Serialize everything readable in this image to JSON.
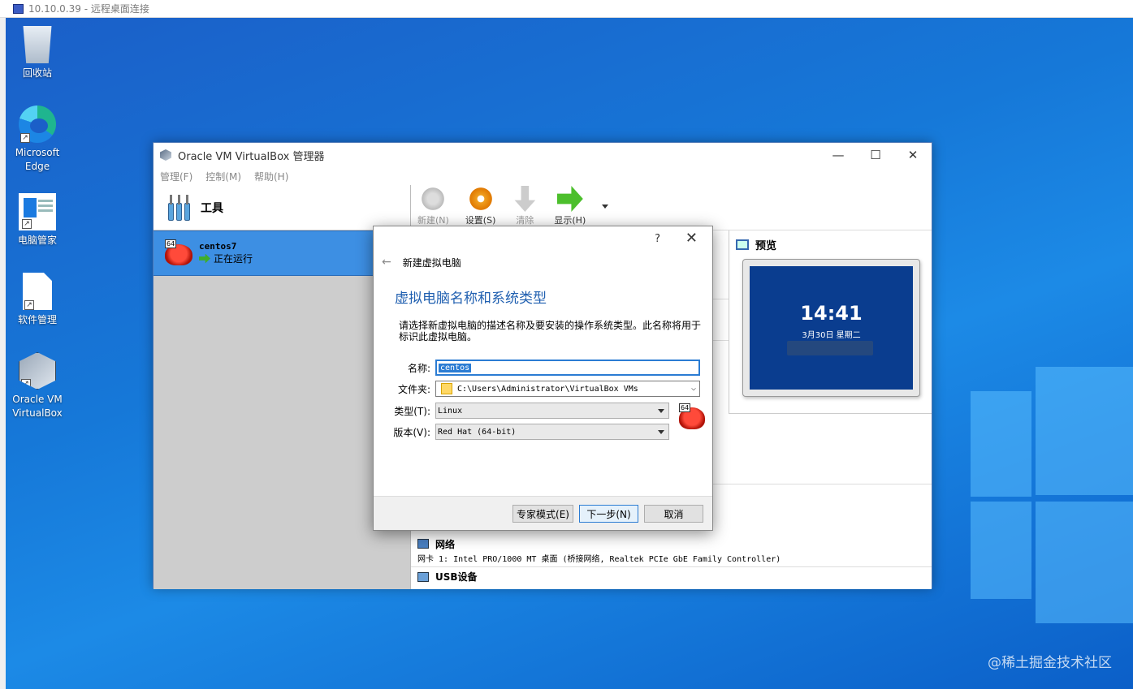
{
  "rdp": {
    "title": "10.10.0.39 - 远程桌面连接"
  },
  "desktop": {
    "icons": [
      {
        "label": "回收站"
      },
      {
        "label": "Microsoft Edge"
      },
      {
        "label": "电脑管家"
      },
      {
        "label": "软件管理"
      },
      {
        "label": "Oracle VM VirtualBox"
      }
    ],
    "watermark": "@稀土掘金技术社区"
  },
  "vbox": {
    "title": "Oracle VM VirtualBox 管理器",
    "controls": {
      "minimize": "—",
      "maximize": "☐",
      "close": "✕"
    },
    "menu": [
      "管理(F)",
      "控制(M)",
      "帮助(H)"
    ],
    "tools_label": "工具",
    "vm": {
      "name": "centos7",
      "state": "正在运行",
      "badge": "64"
    },
    "toolbar": [
      {
        "label": "新建(N)",
        "icon": "new-icon",
        "enabled": false
      },
      {
        "label": "设置(S)",
        "icon": "settings-gear-icon",
        "enabled": true
      },
      {
        "label": "清除",
        "icon": "discard-icon",
        "enabled": false
      },
      {
        "label": "显示(H)",
        "icon": "show-arrow-icon",
        "enabled": true
      }
    ],
    "preview": {
      "title": "预览",
      "time": "14:41",
      "date": "3月30日 星期二"
    },
    "network": {
      "title": "网络",
      "row": "网卡 1:  Intel PRO/1000 MT 桌面 (桥接网络, Realtek PCIe GbE Family Controller)"
    },
    "usb": {
      "title": "USB设备"
    }
  },
  "dialog": {
    "help": "?",
    "close": "✕",
    "nav_title": "新建虚拟电脑",
    "heading": "虚拟电脑名称和系统类型",
    "description": "请选择新虚拟电脑的描述名称及要安装的操作系统类型。此名称将用于标识此虚拟电脑。",
    "fields": {
      "name_label": "名称:",
      "name_value": "centos",
      "folder_label": "文件夹:",
      "folder_value": "C:\\Users\\Administrator\\VirtualBox VMs",
      "type_label": "类型(T):",
      "type_value": "Linux",
      "version_label": "版本(V):",
      "version_value": "Red Hat (64-bit)",
      "os_badge": "64"
    },
    "buttons": {
      "expert": "专家模式(E)",
      "next": "下一步(N)",
      "cancel": "取消"
    }
  }
}
